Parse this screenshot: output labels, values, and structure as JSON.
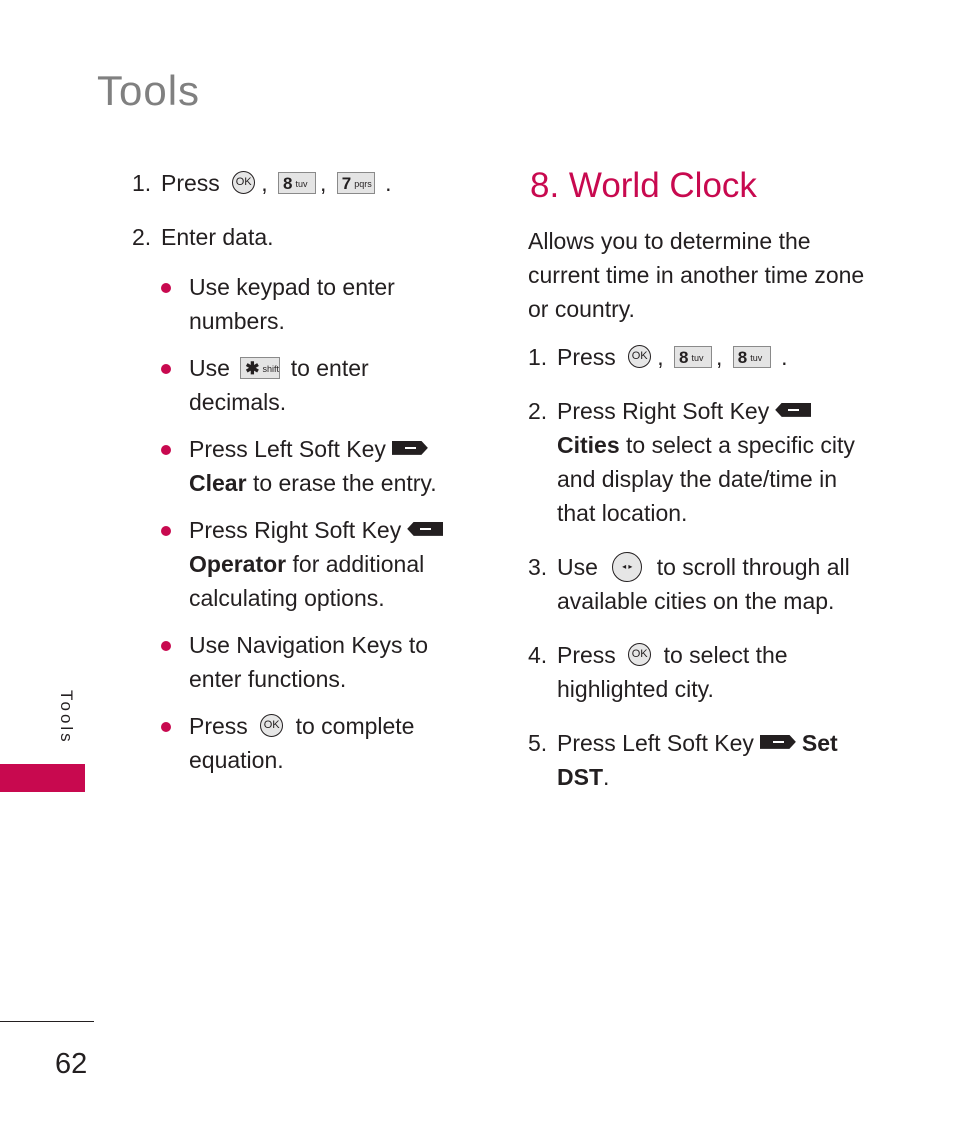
{
  "header": {
    "title": "Tools"
  },
  "side_tab": {
    "label": "Tools",
    "color": "#c8094f"
  },
  "footer": {
    "page_number": "62"
  },
  "accent_color": "#c8094f",
  "left_column": {
    "steps": [
      {
        "num": "1.",
        "text_before": "Press",
        "ok_key": "OK",
        "key1": {
          "digit": "8",
          "letters": "tuv"
        },
        "key2": {
          "digit": "7",
          "letters": "pqrs"
        },
        "sep": ",",
        "end": "."
      },
      {
        "num": "2.",
        "text": "Enter data."
      }
    ],
    "bullets": [
      {
        "text": "Use keypad to enter numbers."
      },
      {
        "before": "Use",
        "key": {
          "symbol": "✱",
          "sub": "shift"
        },
        "after": "to enter decimals."
      },
      {
        "before": "Press Left Soft Key",
        "bold": "Clear",
        "after": "to erase the entry."
      },
      {
        "before": "Press Right Soft Key",
        "bold": "Operator",
        "after": "for additional calculating options."
      },
      {
        "text": "Use Navigation Keys to enter functions."
      },
      {
        "before": "Press",
        "ok_key": "OK",
        "after": "to complete equation."
      }
    ]
  },
  "right_column": {
    "section_title": "8. World Clock",
    "intro": "Allows you to determine the current time in another time zone or country.",
    "steps": [
      {
        "num": "1.",
        "text_before": "Press",
        "ok_key": "OK",
        "key1": {
          "digit": "8",
          "letters": "tuv"
        },
        "key2": {
          "digit": "8",
          "letters": "tuv"
        },
        "sep": ",",
        "end": "."
      },
      {
        "num": "2.",
        "before": "Press Right Soft Key",
        "bold": "Cities",
        "after": "to select a specific city and display the date/time in that location."
      },
      {
        "num": "3.",
        "before": "Use",
        "nav_key": "◂ ▸",
        "after": "to scroll through all available cities on the map."
      },
      {
        "num": "4.",
        "before": "Press",
        "ok_key": "OK",
        "after": "to select the highlighted city."
      },
      {
        "num": "5.",
        "before": "Press Left Soft Key",
        "bold": "Set DST",
        "after": "."
      }
    ]
  }
}
